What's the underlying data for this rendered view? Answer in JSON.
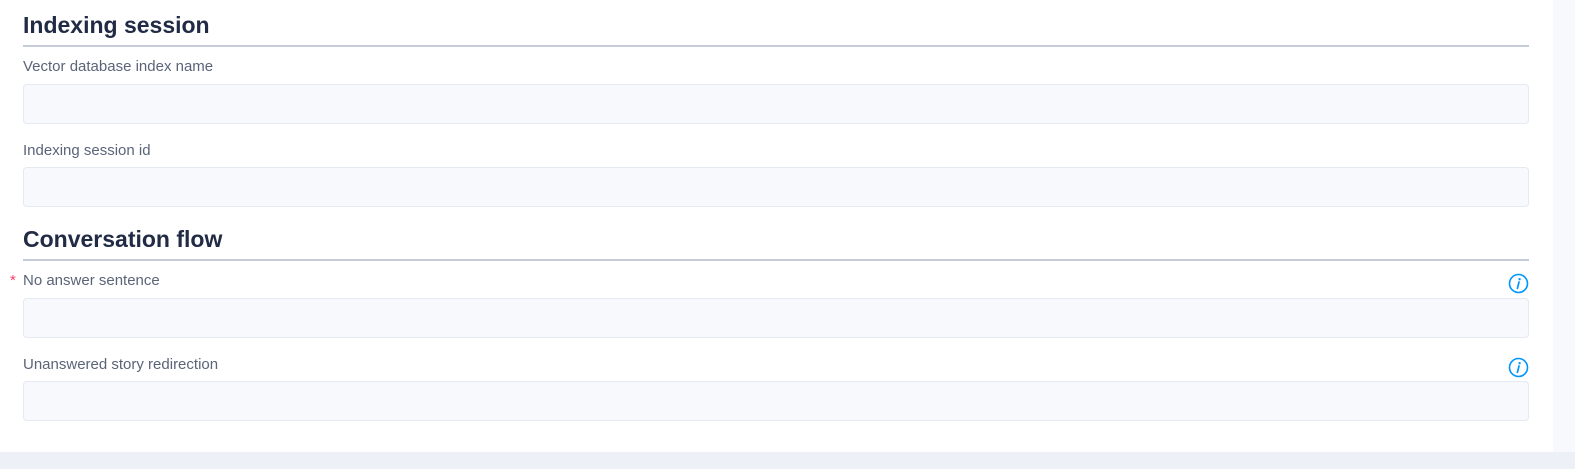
{
  "sections": [
    {
      "title": "Indexing session",
      "fields": [
        {
          "label": "Vector database index name",
          "value": "",
          "required": false,
          "info": false
        },
        {
          "label": "Indexing session id",
          "value": "",
          "required": false,
          "info": false
        }
      ]
    },
    {
      "title": "Conversation flow",
      "fields": [
        {
          "label": "No answer sentence",
          "value": "",
          "required": true,
          "info": true,
          "required_marker": "*"
        },
        {
          "label": "Unanswered story redirection",
          "value": "",
          "required": false,
          "info": true
        }
      ]
    }
  ],
  "colors": {
    "accent": "#0095ff",
    "required": "#ff3d71",
    "heading": "#222b45",
    "label": "#5a6479",
    "input_bg": "#f7f9fc"
  },
  "icons": {
    "info": "info-circle-icon"
  }
}
